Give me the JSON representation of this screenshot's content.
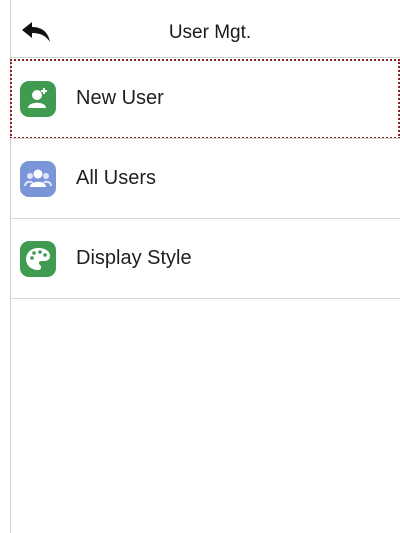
{
  "header": {
    "title": "User Mgt.",
    "back_icon": "back-arrow-icon"
  },
  "menu": {
    "selected_index": 0,
    "items": [
      {
        "label": "New User",
        "icon": "add-user-icon",
        "icon_color": "#3e9b4f"
      },
      {
        "label": "All Users",
        "icon": "users-group-icon",
        "icon_color": "#7a96d8"
      },
      {
        "label": "Display Style",
        "icon": "palette-icon",
        "icon_color": "#3e9b4f"
      }
    ]
  },
  "colors": {
    "selection_outline": "#8a2020",
    "divider": "#d6d6d6"
  }
}
